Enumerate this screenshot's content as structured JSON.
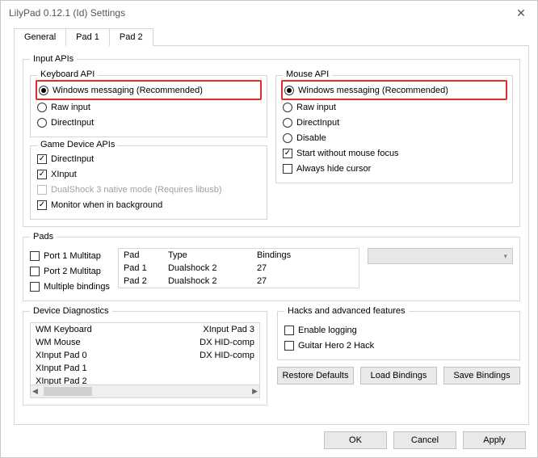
{
  "window": {
    "title": "LilyPad 0.12.1 (Id) Settings"
  },
  "tabs": {
    "t0": "General",
    "t1": "Pad 1",
    "t2": "Pad 2"
  },
  "groups": {
    "input_apis": "Input APIs",
    "keyboard_api": "Keyboard API",
    "mouse_api": "Mouse API",
    "game_device_apis": "Game Device APIs",
    "pads": "Pads",
    "device_diagnostics": "Device Diagnostics",
    "hacks": "Hacks and advanced features"
  },
  "keyboard": {
    "opt_wm": "Windows messaging (Recommended)",
    "opt_raw": "Raw input",
    "opt_di": "DirectInput"
  },
  "mouse": {
    "opt_wm": "Windows messaging (Recommended)",
    "opt_raw": "Raw input",
    "opt_di": "DirectInput",
    "opt_disable": "Disable",
    "chk_start_no_focus": "Start without mouse focus",
    "chk_always_hide": "Always hide cursor"
  },
  "game_device": {
    "chk_di": "DirectInput",
    "chk_xi": "XInput",
    "chk_ds3": "DualShock 3 native mode (Requires libusb)",
    "chk_monitor": "Monitor when in background"
  },
  "pads": {
    "chk_port1": "Port 1 Multitap",
    "chk_port2": "Port 2 Multitap",
    "chk_multi": "Multiple bindings",
    "head_pad": "Pad",
    "head_type": "Type",
    "head_bindings": "Bindings",
    "rows": [
      {
        "pad": "Pad 1",
        "type": "Dualshock 2",
        "bindings": "27"
      },
      {
        "pad": "Pad 2",
        "type": "Dualshock 2",
        "bindings": "27"
      }
    ]
  },
  "diagnostics": {
    "rows": [
      {
        "l": "WM Keyboard",
        "r": "XInput Pad 3"
      },
      {
        "l": "WM Mouse",
        "r": "DX HID-comp"
      },
      {
        "l": "XInput Pad 0",
        "r": "DX HID-comp"
      },
      {
        "l": "XInput Pad 1",
        "r": ""
      },
      {
        "l": "XInput Pad 2",
        "r": ""
      }
    ]
  },
  "hacks": {
    "chk_log": "Enable logging",
    "chk_gh2": "Guitar Hero 2 Hack"
  },
  "buttons": {
    "restore": "Restore Defaults",
    "load": "Load Bindings",
    "save": "Save Bindings",
    "ok": "OK",
    "cancel": "Cancel",
    "apply": "Apply"
  }
}
